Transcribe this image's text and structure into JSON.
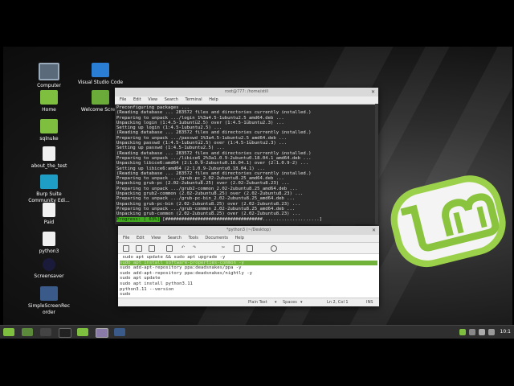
{
  "desktop": {
    "icons": [
      {
        "label": "Computer"
      },
      {
        "label": "Visual Studio Code"
      },
      {
        "label": "Home"
      },
      {
        "label": "Welcome Scre..."
      },
      {
        "label": "sqlnuke"
      },
      {
        "label": "about_the_test"
      },
      {
        "label": "Burp Suite Community Edi..."
      },
      {
        "label": "Paid"
      },
      {
        "label": "python3"
      },
      {
        "label": "Screensaver"
      },
      {
        "label": "SimpleScreenRec order"
      }
    ]
  },
  "terminal": {
    "title": "root@777: /home/still",
    "menu": [
      "File",
      "Edit",
      "View",
      "Search",
      "Terminal",
      "Help"
    ],
    "lines": [
      "Preconfiguring packages ...",
      "(Reading database ... 283572 files and directories currently installed.)",
      "Preparing to unpack .../login_1%3a4.5-1ubuntu2.5_amd64.deb ...",
      "Unpacking login (1:4.5-1ubuntu2.5) over (1:4.5-1ubuntu2.3) ...",
      "Setting up login (1:4.5-1ubuntu2.5) ...",
      "(Reading database ... 283572 files and directories currently installed.)",
      "Preparing to unpack .../passwd_1%3a4.5-1ubuntu2.5_amd64.deb ...",
      "Unpacking passwd (1:4.5-1ubuntu2.5) over (1:4.5-1ubuntu2.3) ...",
      "Setting up passwd (1:4.5-1ubuntu2.5) ...",
      "(Reading database ... 283572 files and directories currently installed.)",
      "Preparing to unpack .../libice6_2%3a1.0.9-2ubuntu0.18.04.1_amd64.deb ...",
      "Unpacking libice6:amd64 (2:1.0.9-2ubuntu0.18.04.1) over (2:1.0.9-2) ...",
      "Setting up libice6:amd64 (2:1.0.9-2ubuntu0.18.04.1) ...",
      "(Reading database ... 283572 files and directories currently installed.)",
      "Preparing to unpack .../grub-pc_2.02-2ubuntu8.25_amd64.deb ...",
      "Unpacking grub-pc (2.02-2ubuntu8.25) over (2.02-2ubuntu8.23) ...",
      "Preparing to unpack .../grub2-common_2.02-2ubuntu8.25_amd64.deb ...",
      "Unpacking grub2-common (2.02-2ubuntu8.25) over (2.02-2ubuntu8.23) ...",
      "Preparing to unpack .../grub-pc-bin_2.02-2ubuntu8.25_amd64.deb ...",
      "Unpacking grub-pc-bin (2.02-2ubuntu8.25) over (2.02-2ubuntu8.23) ...",
      "Preparing to unpack .../grub-common_2.02-2ubuntu8.25_amd64.deb ...",
      "Unpacking grub-common (2.02-2ubuntu8.25) over (2.02-2ubuntu8.23) ..."
    ],
    "progress_label": "Progress: [ 63%]",
    "progress_bar": " [####################################.....................]",
    "progress_percent": 63
  },
  "editor": {
    "title": "*python3 (~/Desktop)",
    "menu": [
      "File",
      "Edit",
      "View",
      "Search",
      "Tools",
      "Documents",
      "Help"
    ],
    "lines": [
      " sudo apt update && sudo apt upgrade -y",
      "sudo apt install software-properties-common -y",
      "sudo add-apt-repository ppa:deadsnakes/ppa -y",
      "sudo add-apt-repository ppa:deadsnakes/nightly -y",
      "sudo apt update",
      "sudo apt install python3.11",
      "python3.11 --version",
      "sudo"
    ],
    "highlighted_line_index": 1,
    "status": {
      "language": "Plain Text",
      "indent": "Spaces",
      "position": "Ln 2, Col 1",
      "mode": "INS"
    }
  },
  "panel": {
    "clock": "10:1"
  },
  "colors": {
    "mint_green": "#8ac33e",
    "terminal_bg": "#2b2b2b",
    "highlight": "#71b33a"
  }
}
